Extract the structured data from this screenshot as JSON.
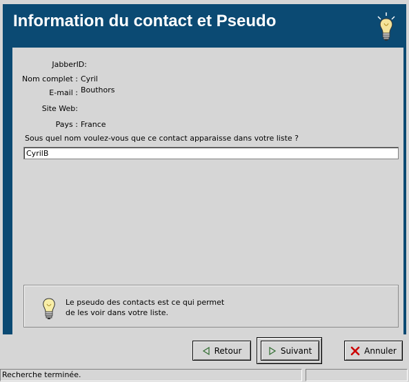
{
  "header": {
    "title": "Information du contact et Pseudo"
  },
  "contact": {
    "fields": [
      {
        "label": "JabberID:",
        "value": ""
      },
      {
        "label": "Nom complet :",
        "value": "Cyril Bouthors"
      },
      {
        "label": "E-mail :",
        "value": ""
      },
      {
        "label": "Site Web:",
        "value": ""
      },
      {
        "label": "Pays :",
        "value": "France"
      }
    ]
  },
  "nickname": {
    "question": "Sous quel nom voulez-vous que ce contact apparaisse dans votre liste ?",
    "value": "CyrilB"
  },
  "tip": {
    "line1": "Le pseudo des contacts est ce qui permet",
    "line2": "de les voir dans votre liste."
  },
  "buttons": {
    "back_label": "Retour",
    "next_label": "Suivant",
    "cancel_label": "Annuler"
  },
  "status": {
    "text": "Recherche terminée.",
    "secondary": ""
  },
  "colors": {
    "header_bg": "#0b4a73",
    "cancel_x": "#cc0000",
    "arrow_fill": "#2e8b2e"
  },
  "icons": {
    "header": "lightbulb-icon",
    "tip": "lightbulb-icon",
    "back": "arrow-left-icon",
    "next": "arrow-right-icon",
    "cancel": "close-icon"
  }
}
